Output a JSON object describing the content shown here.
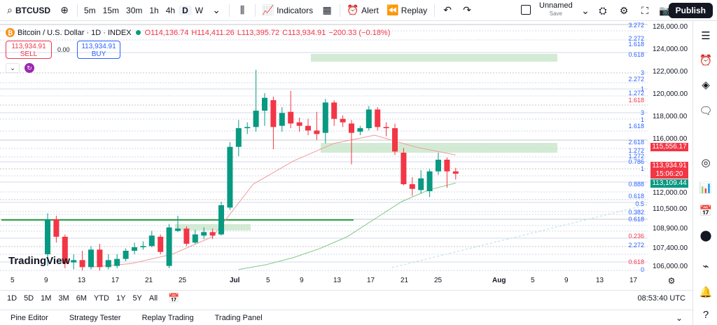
{
  "topbar": {
    "symbol": "BTCUSD",
    "timeframes": [
      "5m",
      "15m",
      "30m",
      "1h",
      "4h",
      "D",
      "W"
    ],
    "active_timeframe": "D",
    "indicators_label": "Indicators",
    "alert_label": "Alert",
    "replay_label": "Replay",
    "layout_name": "Unnamed",
    "layout_status": "Save",
    "publish_label": "Publish"
  },
  "legend": {
    "title": "Bitcoin / U.S. Dollar · 1D · INDEX",
    "open": "O114,136.74",
    "high": "H114,411.26",
    "low": "L113,395.72",
    "close": "C113,934.91",
    "change": "−200.33 (−0.18%)"
  },
  "trade": {
    "sell_price": "113,934.91",
    "sell_label": "SELL",
    "spread": "0.00",
    "buy_price": "113,934.91",
    "buy_label": "BUY"
  },
  "watermark": "TradingView",
  "price_axis": [
    "126,000.00",
    "124,000.00",
    "122,000.00",
    "120,000.00",
    "118,000.00",
    "116,000.00",
    "112,000.00",
    "110,500.00",
    "108,900.00",
    "107,400.00",
    "106,000.00"
  ],
  "price_tags": {
    "upper": "115,556.17",
    "current": "113,934.91",
    "countdown": "15:06:20",
    "lower": "113,109.44"
  },
  "fib_labels": [
    "3.272",
    "2.272",
    "1.618",
    "0.618",
    "3",
    "2.272",
    "1",
    "1.272",
    "1.618",
    "3",
    "1",
    "1.618",
    "2.618",
    "1.272",
    "1.272",
    "0.786",
    "1",
    "0.888",
    "0.618",
    "0.5",
    "0.382",
    "0.618",
    "0.236",
    "2.272",
    "0.618",
    "0"
  ],
  "date_axis": [
    "5",
    "9",
    "13",
    "17",
    "21",
    "25",
    "Jul",
    "5",
    "9",
    "13",
    "17",
    "21",
    "25",
    "Aug",
    "5",
    "9",
    "13",
    "17"
  ],
  "ranges": [
    "1D",
    "5D",
    "1M",
    "3M",
    "6M",
    "YTD",
    "1Y",
    "5Y",
    "All"
  ],
  "time_readout": "08:53:40 UTC",
  "bottom_tabs": [
    "Pine Editor",
    "Strategy Tester",
    "Replay Trading",
    "Trading Panel"
  ],
  "colors": {
    "up": "#089981",
    "down": "#f23645",
    "accent": "#2962ff"
  },
  "chart_data": {
    "type": "candlestick",
    "title": "Bitcoin / U.S. Dollar · 1D · INDEX",
    "ylim": [
      105500,
      126500
    ],
    "candles": [
      {
        "o": 107000,
        "c": 110000,
        "h": 110500,
        "l": 106000
      },
      {
        "o": 110000,
        "c": 108500,
        "h": 110300,
        "l": 108000
      },
      {
        "o": 108500,
        "c": 106200,
        "h": 108700,
        "l": 105800
      },
      {
        "o": 106300,
        "c": 106500,
        "h": 107000,
        "l": 105700
      },
      {
        "o": 106500,
        "c": 105900,
        "h": 107300,
        "l": 105600
      },
      {
        "o": 105900,
        "c": 107400,
        "h": 107700,
        "l": 105700
      },
      {
        "o": 107400,
        "c": 105900,
        "h": 107900,
        "l": 105600
      },
      {
        "o": 105900,
        "c": 106500,
        "h": 107000,
        "l": 105700
      },
      {
        "o": 106000,
        "c": 106600,
        "h": 107000,
        "l": 105800
      },
      {
        "o": 106600,
        "c": 107300,
        "h": 107500,
        "l": 106400
      },
      {
        "o": 107300,
        "c": 107600,
        "h": 108000,
        "l": 107000
      },
      {
        "o": 107600,
        "c": 107700,
        "h": 108100,
        "l": 107400
      },
      {
        "o": 107700,
        "c": 108600,
        "h": 109000,
        "l": 107600
      },
      {
        "o": 108500,
        "c": 107200,
        "h": 108700,
        "l": 107000
      },
      {
        "o": 106000,
        "c": 109300,
        "h": 109600,
        "l": 105800
      },
      {
        "o": 109000,
        "c": 109200,
        "h": 110300,
        "l": 108900
      },
      {
        "o": 109200,
        "c": 107900,
        "h": 109400,
        "l": 107700
      },
      {
        "o": 108000,
        "c": 108700,
        "h": 109100,
        "l": 107900
      },
      {
        "o": 108600,
        "c": 108900,
        "h": 109300,
        "l": 108300
      },
      {
        "o": 108900,
        "c": 108600,
        "h": 109200,
        "l": 108300
      },
      {
        "o": 108700,
        "c": 111200,
        "h": 111500,
        "l": 108600
      },
      {
        "o": 111000,
        "c": 116200,
        "h": 116600,
        "l": 110800
      },
      {
        "o": 116200,
        "c": 117800,
        "h": 118500,
        "l": 115400
      },
      {
        "o": 117800,
        "c": 117900,
        "h": 118300,
        "l": 117300
      },
      {
        "o": 117900,
        "c": 119300,
        "h": 122800,
        "l": 117500
      },
      {
        "o": 119300,
        "c": 120400,
        "h": 120800,
        "l": 118000
      },
      {
        "o": 120200,
        "c": 117900,
        "h": 120500,
        "l": 116000
      },
      {
        "o": 118000,
        "c": 119100,
        "h": 119600,
        "l": 117500
      },
      {
        "o": 119200,
        "c": 118200,
        "h": 121000,
        "l": 117800
      },
      {
        "o": 118300,
        "c": 118000,
        "h": 118700,
        "l": 117500
      },
      {
        "o": 118000,
        "c": 117600,
        "h": 118600,
        "l": 117200
      },
      {
        "o": 117600,
        "c": 117300,
        "h": 119200,
        "l": 116800
      },
      {
        "o": 117400,
        "c": 120000,
        "h": 120300,
        "l": 116500
      },
      {
        "o": 120000,
        "c": 118600,
        "h": 120200,
        "l": 118000
      },
      {
        "o": 118600,
        "c": 118300,
        "h": 118900,
        "l": 117900
      },
      {
        "o": 118200,
        "c": 117400,
        "h": 118500,
        "l": 114700
      },
      {
        "o": 117500,
        "c": 117800,
        "h": 118000,
        "l": 117200
      },
      {
        "o": 117800,
        "c": 119400,
        "h": 119700,
        "l": 117600
      },
      {
        "o": 119400,
        "c": 117900,
        "h": 119600,
        "l": 117600
      },
      {
        "o": 117900,
        "c": 117800,
        "h": 118300,
        "l": 117100
      },
      {
        "o": 117800,
        "c": 115800,
        "h": 118200,
        "l": 115500
      },
      {
        "o": 115700,
        "c": 113000,
        "h": 116100,
        "l": 112900
      },
      {
        "o": 113000,
        "c": 112600,
        "h": 113600,
        "l": 112000
      },
      {
        "o": 112500,
        "c": 113500,
        "h": 114200,
        "l": 112200
      },
      {
        "o": 112400,
        "c": 114100,
        "h": 114300,
        "l": 111900
      },
      {
        "o": 114100,
        "c": 115100,
        "h": 115700,
        "l": 113800
      },
      {
        "o": 115100,
        "c": 114100,
        "h": 115300,
        "l": 112700
      },
      {
        "o": 114100,
        "c": 113900,
        "h": 114400,
        "l": 113400
      }
    ],
    "ma_slow": [
      105700,
      106100,
      106700,
      107500,
      108500,
      110000,
      111500,
      112500,
      113100
    ],
    "ma_fast": [
      105900,
      106200,
      107000,
      108500,
      113000,
      115000,
      116500,
      117200,
      116200,
      115500
    ]
  }
}
